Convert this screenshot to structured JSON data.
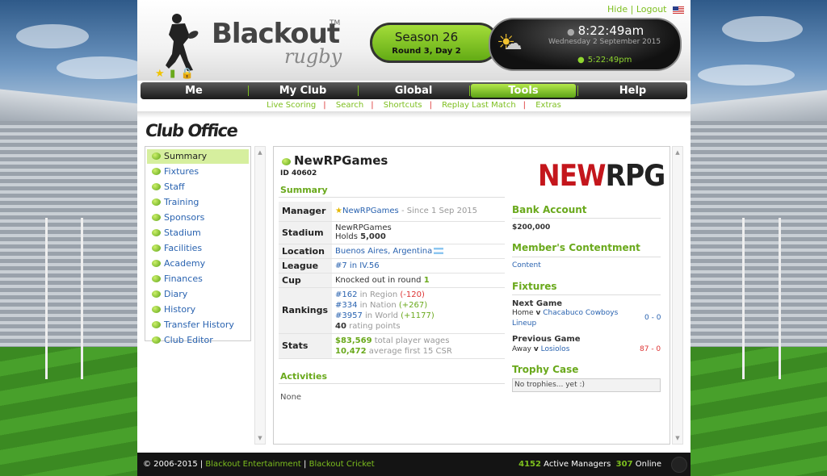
{
  "top_links": {
    "hide": "Hide",
    "sep": "|",
    "logout": "Logout"
  },
  "logo": {
    "brand": "Blackout",
    "sub": "rugby",
    "tm": "TM"
  },
  "season": {
    "title": "Season 26",
    "round": "Round 3, Day 2"
  },
  "clock": {
    "time": "8:22:49am",
    "date": "Wednesday 2 September 2015",
    "local_time": "5:22:49pm"
  },
  "nav": {
    "items": [
      "Me",
      "My Club",
      "Global",
      "Tools",
      "Help"
    ],
    "active": "Tools"
  },
  "subnav": [
    "Live Scoring",
    "Search",
    "Shortcuts",
    "Replay Last Match",
    "Extras"
  ],
  "page_title": "Club Office",
  "sidebar": {
    "items": [
      "Summary",
      "Fixtures",
      "Staff",
      "Training",
      "Sponsors",
      "Stadium",
      "Facilities",
      "Academy",
      "Finances",
      "Diary",
      "History",
      "Transfer History",
      "Club Editor"
    ],
    "active": "Summary"
  },
  "club": {
    "name": "NewRPGames",
    "id": "ID 40602"
  },
  "summary": {
    "heading": "Summary",
    "manager": {
      "label": "Manager",
      "name": "NewRPGames",
      "since": "- Since 1 Sep 2015"
    },
    "stadium": {
      "label": "Stadium",
      "name": "NewRPGames",
      "holds_label": "Holds",
      "holds": "5,000"
    },
    "location": {
      "label": "Location",
      "value": "Buenos Aires, Argentina"
    },
    "league": {
      "label": "League",
      "value": "#7 in IV.56"
    },
    "cup": {
      "label": "Cup",
      "text": "Knocked out in round",
      "round": "1"
    },
    "rankings": {
      "label": "Rankings",
      "region": {
        "rank": "#162",
        "in": "in Region",
        "change": "(-120)"
      },
      "nation": {
        "rank": "#334",
        "in": "in Nation",
        "change": "(+267)"
      },
      "world": {
        "rank": "#3957",
        "in": "in World",
        "change": "(+1177)"
      },
      "points": "40",
      "points_label": "rating points"
    },
    "stats": {
      "label": "Stats",
      "wages": "$83,569",
      "wages_label": "total player wages",
      "csr": "10,472",
      "csr_label": "average first 15 CSR"
    }
  },
  "activities": {
    "heading": "Activities",
    "text": "None"
  },
  "sponsor_logo": {
    "part_a": "NEW",
    "part_b": "RPG"
  },
  "bank": {
    "heading": "Bank Account",
    "value": "$200,000"
  },
  "contentment": {
    "heading": "Member's Contentment",
    "value": "Content"
  },
  "fixtures": {
    "heading": "Fixtures",
    "next_label": "Next Game",
    "next_venue": "Home",
    "next_v": "v",
    "next_opp": "Chacabuco Cowboys",
    "next_lineup": "Lineup",
    "next_score": "0 - 0",
    "prev_label": "Previous Game",
    "prev_venue": "Away",
    "prev_v": "v",
    "prev_opp": "Losiolos",
    "prev_score": "87 - 0"
  },
  "trophy": {
    "heading": "Trophy Case",
    "text": "No trophies... yet :)"
  },
  "footer": {
    "copyright": "© 2006-2015 |",
    "link1": "Blackout Entertainment",
    "sep": "|",
    "link2": "Blackout Cricket",
    "managers": "4152",
    "managers_label": "Active Managers",
    "online": "307",
    "online_label": "Online"
  },
  "colors": {
    "accent": "#7dbf1e",
    "link": "#2a63b0",
    "negative": "#d33333",
    "logo_red": "#c4161c"
  }
}
